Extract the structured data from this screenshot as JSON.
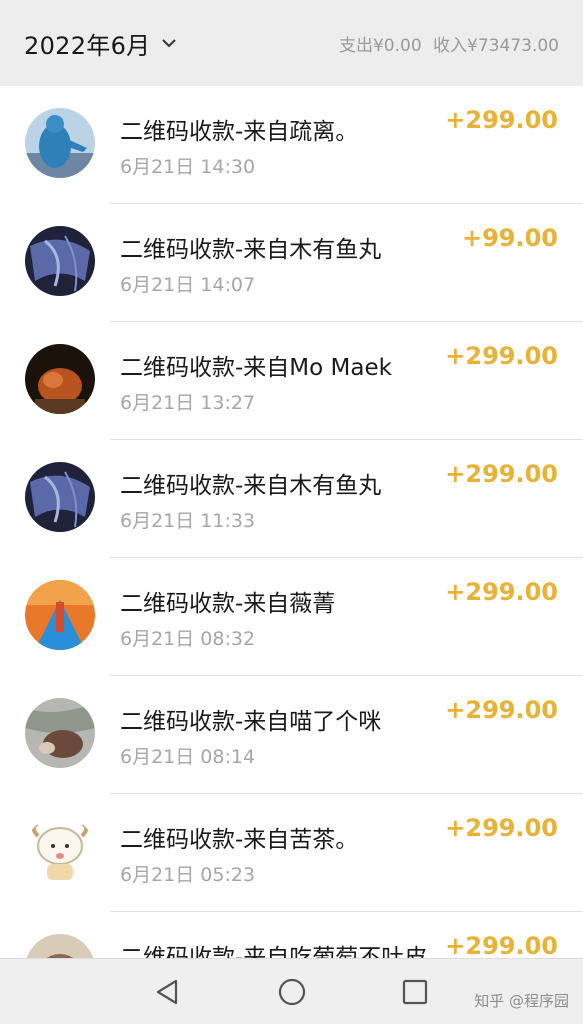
{
  "header": {
    "month": "2022年6月",
    "expense": "支出¥0.00",
    "income": "收入¥73473.00"
  },
  "transactions": [
    {
      "title": "二维码收款-来自疏离。",
      "time": "6月21日 14:30",
      "amount": "+299.00"
    },
    {
      "title": "二维码收款-来自木有鱼丸",
      "time": "6月21日 14:07",
      "amount": "+99.00"
    },
    {
      "title": "二维码收款-来自Mo Maek",
      "time": "6月21日 13:27",
      "amount": "+299.00"
    },
    {
      "title": "二维码收款-来自木有鱼丸",
      "time": "6月21日 11:33",
      "amount": "+299.00"
    },
    {
      "title": "二维码收款-来自薇菁",
      "time": "6月21日 08:32",
      "amount": "+299.00"
    },
    {
      "title": "二维码收款-来自喵了个咪",
      "time": "6月21日 08:14",
      "amount": "+299.00"
    },
    {
      "title": "二维码收款-来自苦茶。",
      "time": "6月21日 05:23",
      "amount": "+299.00"
    },
    {
      "title": "二维码收款-来自吃葡萄不吐皮",
      "time": "",
      "amount": "+299.00"
    }
  ],
  "watermark": "知乎 @程序园",
  "colors": {
    "amount": "#e8b236",
    "header_bg": "#ededed"
  }
}
